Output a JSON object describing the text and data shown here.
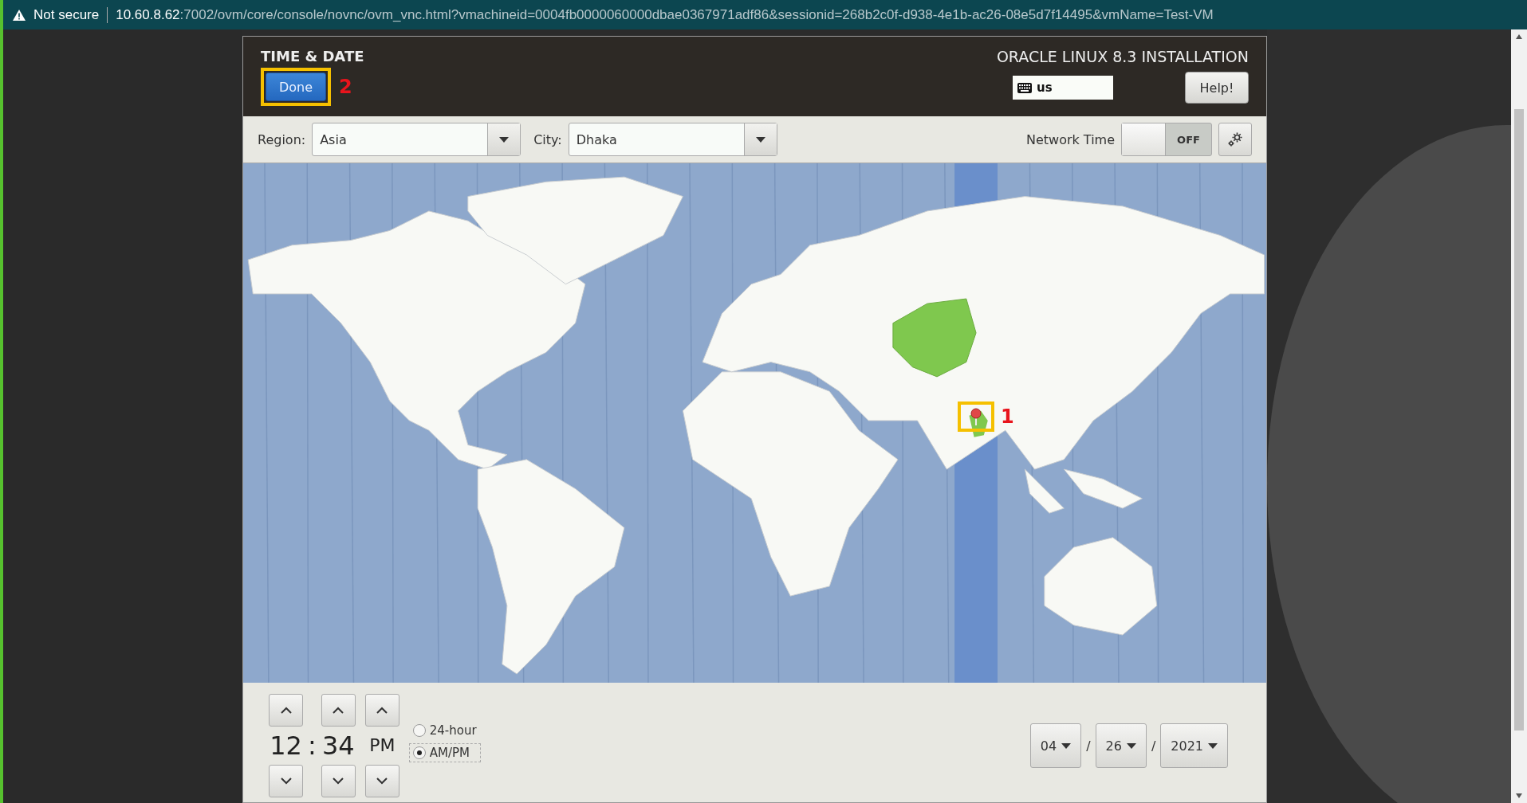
{
  "address_bar": {
    "security": "Not secure",
    "url": "**10.60.8.62**:7002/ovm/core/console/novnc/ovm_vnc.html?vmachineid=0004fb0000060000dbae0367971adf86&sessionid=268b2c0f-d938-4e1b-ac26-08e5d7f14495&vmName=Test-VM"
  },
  "header": {
    "title": "TIME & DATE",
    "done_button": "Done",
    "done_annotation": "2",
    "product": "ORACLE LINUX 8.3 INSTALLATION",
    "keyboard_layout": "us",
    "help_button": "Help!"
  },
  "toolbar": {
    "region_label": "Region:",
    "region": "Asia",
    "city_label": "City:",
    "city": "Dhaka",
    "network_time_label": "Network Time",
    "network_time": {
      "on": false,
      "label": "OFF"
    }
  },
  "map": {
    "pin_annotation": "1"
  },
  "time": {
    "hours": "12",
    "separator": ":",
    "minutes": "34",
    "period": "PM"
  },
  "formats": [
    {
      "label": "24-hour",
      "selected": false
    },
    {
      "label": "AM/PM",
      "selected": true
    }
  ],
  "date": {
    "month": "04",
    "day": "26",
    "year": "2021",
    "separators": [
      "/",
      "/"
    ]
  }
}
